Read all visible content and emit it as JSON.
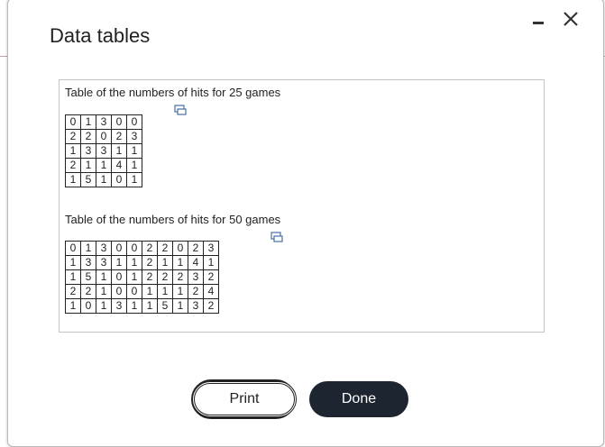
{
  "dialog": {
    "title": "Data tables",
    "minimize_icon": "minimize-icon",
    "close_icon": "close-icon"
  },
  "table25": {
    "caption": "Table of the numbers of hits for 25 games",
    "copy_icon": "copy-icon",
    "rows": [
      [
        "0",
        "1",
        "3",
        "0",
        "0"
      ],
      [
        "2",
        "2",
        "0",
        "2",
        "3"
      ],
      [
        "1",
        "3",
        "3",
        "1",
        "1"
      ],
      [
        "2",
        "1",
        "1",
        "4",
        "1"
      ],
      [
        "1",
        "5",
        "1",
        "0",
        "1"
      ]
    ]
  },
  "table50": {
    "caption": "Table of the numbers of hits for 50 games",
    "copy_icon": "copy-icon",
    "rows": [
      [
        "0",
        "1",
        "3",
        "0",
        "0",
        "2",
        "2",
        "0",
        "2",
        "3"
      ],
      [
        "1",
        "3",
        "3",
        "1",
        "1",
        "2",
        "1",
        "1",
        "4",
        "1"
      ],
      [
        "1",
        "5",
        "1",
        "0",
        "1",
        "2",
        "2",
        "2",
        "3",
        "2"
      ],
      [
        "2",
        "2",
        "1",
        "0",
        "0",
        "1",
        "1",
        "1",
        "2",
        "4"
      ],
      [
        "1",
        "0",
        "1",
        "3",
        "1",
        "1",
        "5",
        "1",
        "3",
        "2"
      ]
    ]
  },
  "buttons": {
    "print_label": "Print",
    "done_label": "Done"
  },
  "colors": {
    "done_bg": "#1d2530",
    "border": "#c4c4c4"
  }
}
